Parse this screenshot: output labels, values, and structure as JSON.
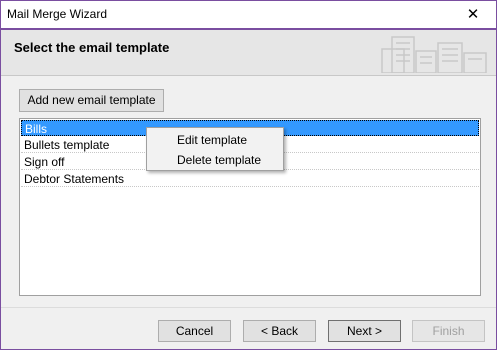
{
  "window": {
    "title": "Mail Merge Wizard",
    "close_glyph": "✕"
  },
  "header": {
    "title": "Select the email template",
    "art_icon": "buildings-icon"
  },
  "toolbar": {
    "add_label": "Add new email template"
  },
  "templates": {
    "items": [
      "Bills",
      "Bullets template",
      "Sign off",
      "Debtor Statements"
    ],
    "selected": "Bills"
  },
  "context_menu": {
    "items": [
      "Edit template",
      "Delete template"
    ]
  },
  "footer": {
    "cancel": "Cancel",
    "back": "< Back",
    "next": "Next >",
    "finish": "Finish"
  },
  "colors": {
    "accent": "#7a4ea0",
    "selection": "#3399ff"
  }
}
